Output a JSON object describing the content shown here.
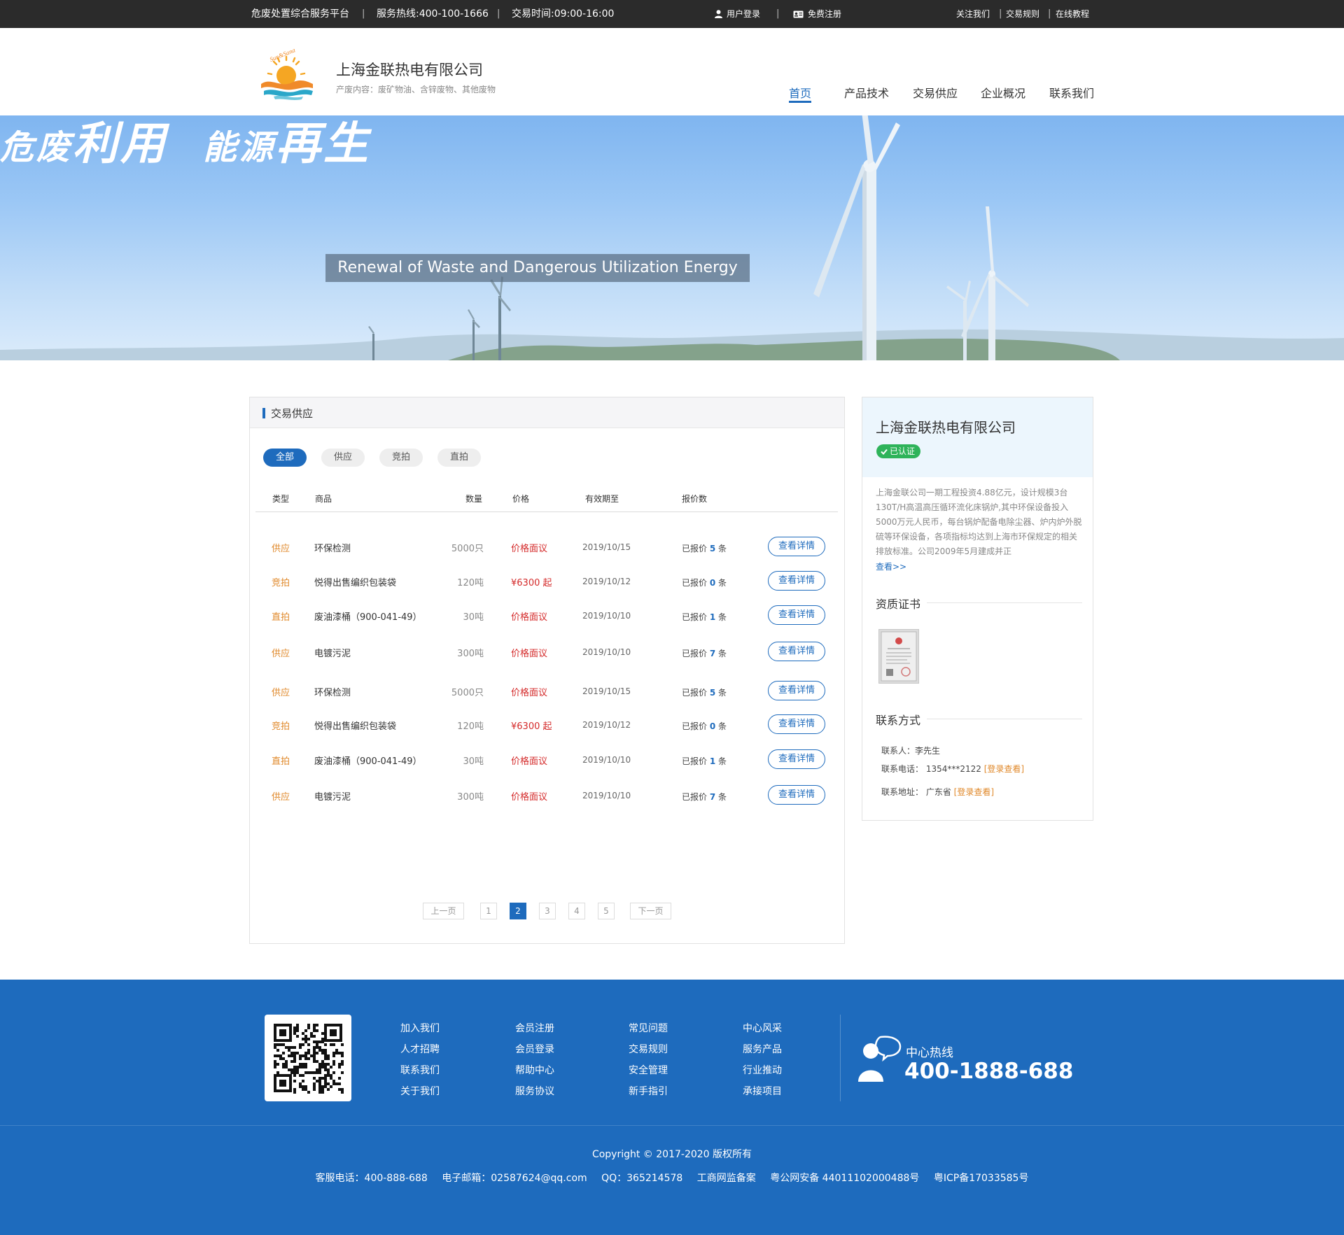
{
  "topbar": {
    "platform": "危废处置综合服务平台",
    "hotline": "服务热线:400-100-1666",
    "hours": "交易时间:09:00-16:00",
    "login": "用户登录",
    "register": "免费注册",
    "follow": "关注我们",
    "rules": "交易规则",
    "tutorial": "在线教程",
    "separator": "|"
  },
  "header": {
    "company_name": "上海金联热电有限公司",
    "company_sub": "产废内容：废矿物油、含锌废物、其他废物",
    "logo_text": "Sun&Sand",
    "nav": [
      "首页",
      "产品技术",
      "交易供应",
      "企业概况",
      "联系我们"
    ]
  },
  "banner": {
    "title_cn": "危废利用  能源再生",
    "title_part1": "危废",
    "title_part2": "利用",
    "title_part3": "能源",
    "title_part4": "再生",
    "subtitle_en": "Renewal of Waste and Dangerous Utilization Energy"
  },
  "trade": {
    "section_title": "交易供应",
    "filters": [
      "全部",
      "供应",
      "竞拍",
      "直拍"
    ],
    "columns": [
      "类型",
      "商品",
      "数量",
      "价格",
      "有效期至",
      "报价数"
    ],
    "bid_prefix": "已报价",
    "bid_suffix": "条",
    "detail_label": "查看详情",
    "rows": [
      {
        "type": "供应",
        "goods": "环保检测",
        "qty": "5000只",
        "price": "价格面议",
        "date": "2019/10/15",
        "bids": "5"
      },
      {
        "type": "竞拍",
        "goods": "悦得出售编织包装袋",
        "qty": "120吨",
        "price": "¥6300 起",
        "date": "2019/10/12",
        "bids": "0"
      },
      {
        "type": "直拍",
        "goods": "废油漆桶（900-041-49）",
        "qty": "30吨",
        "price": "价格面议",
        "date": "2019/10/10",
        "bids": "1"
      },
      {
        "type": "供应",
        "goods": "电镀污泥",
        "qty": "300吨",
        "price": "价格面议",
        "date": "2019/10/10",
        "bids": "7"
      },
      {
        "type": "供应",
        "goods": "环保检测",
        "qty": "5000只",
        "price": "价格面议",
        "date": "2019/10/15",
        "bids": "5"
      },
      {
        "type": "竞拍",
        "goods": "悦得出售编织包装袋",
        "qty": "120吨",
        "price": "¥6300 起",
        "date": "2019/10/12",
        "bids": "0"
      },
      {
        "type": "直拍",
        "goods": "废油漆桶（900-041-49）",
        "qty": "30吨",
        "price": "价格面议",
        "date": "2019/10/10",
        "bids": "1"
      },
      {
        "type": "供应",
        "goods": "电镀污泥",
        "qty": "300吨",
        "price": "价格面议",
        "date": "2019/10/10",
        "bids": "7"
      }
    ],
    "pagination": {
      "prev": "上一页",
      "next": "下一页",
      "pages": [
        "1",
        "2",
        "3",
        "4",
        "5"
      ],
      "current": "2"
    }
  },
  "sidebar": {
    "company_name": "上海金联热电有限公司",
    "verified": "已认证",
    "description": "上海金联公司一期工程投资4.88亿元，设计规模3台130T/H高温高压循环流化床锅炉,其中环保设备投入5000万元人民币，每台锅炉配备电除尘器、炉内炉外脱硫等环保设备，各项指标均达到上海市环保规定的相关排放标准。公司2009年5月建成并正",
    "more": "查看>>",
    "cert_title": "资质证书",
    "contact_title": "联系方式",
    "contact_person": "联系人：李先生",
    "contact_phone": "联系电话：  1354***2122",
    "contact_phone_link": "[登录查看]",
    "contact_address": "联系地址：  广东省",
    "contact_address_link": "[登录查看]"
  },
  "footer": {
    "links": [
      [
        "加入我们",
        "人才招聘",
        "联系我们",
        "关于我们"
      ],
      [
        "会员注册",
        "会员登录",
        "帮助中心",
        "服务协议"
      ],
      [
        "常见问题",
        "交易规则",
        "安全管理",
        "新手指引"
      ],
      [
        "中心风采",
        "服务产品",
        "行业推动",
        "承接项目"
      ]
    ],
    "hotline_label": "中心热线",
    "hotline_number": "400-1888-688",
    "copyright": "Copyright © 2017-2020  版权所有",
    "info": [
      "客服电话：400-888-688",
      "电子邮箱：02587624@qq.com",
      "QQ：365214578",
      "工商网监备案",
      "粤公网安备 44011102000488号",
      "粤ICP备17033585号"
    ]
  },
  "colors": {
    "primary": "#1e6bbd",
    "accent_orange": "#e0892b",
    "price_red": "#d42a2a",
    "verified_green": "#2eb35a",
    "topbar": "#2b2b2b"
  }
}
